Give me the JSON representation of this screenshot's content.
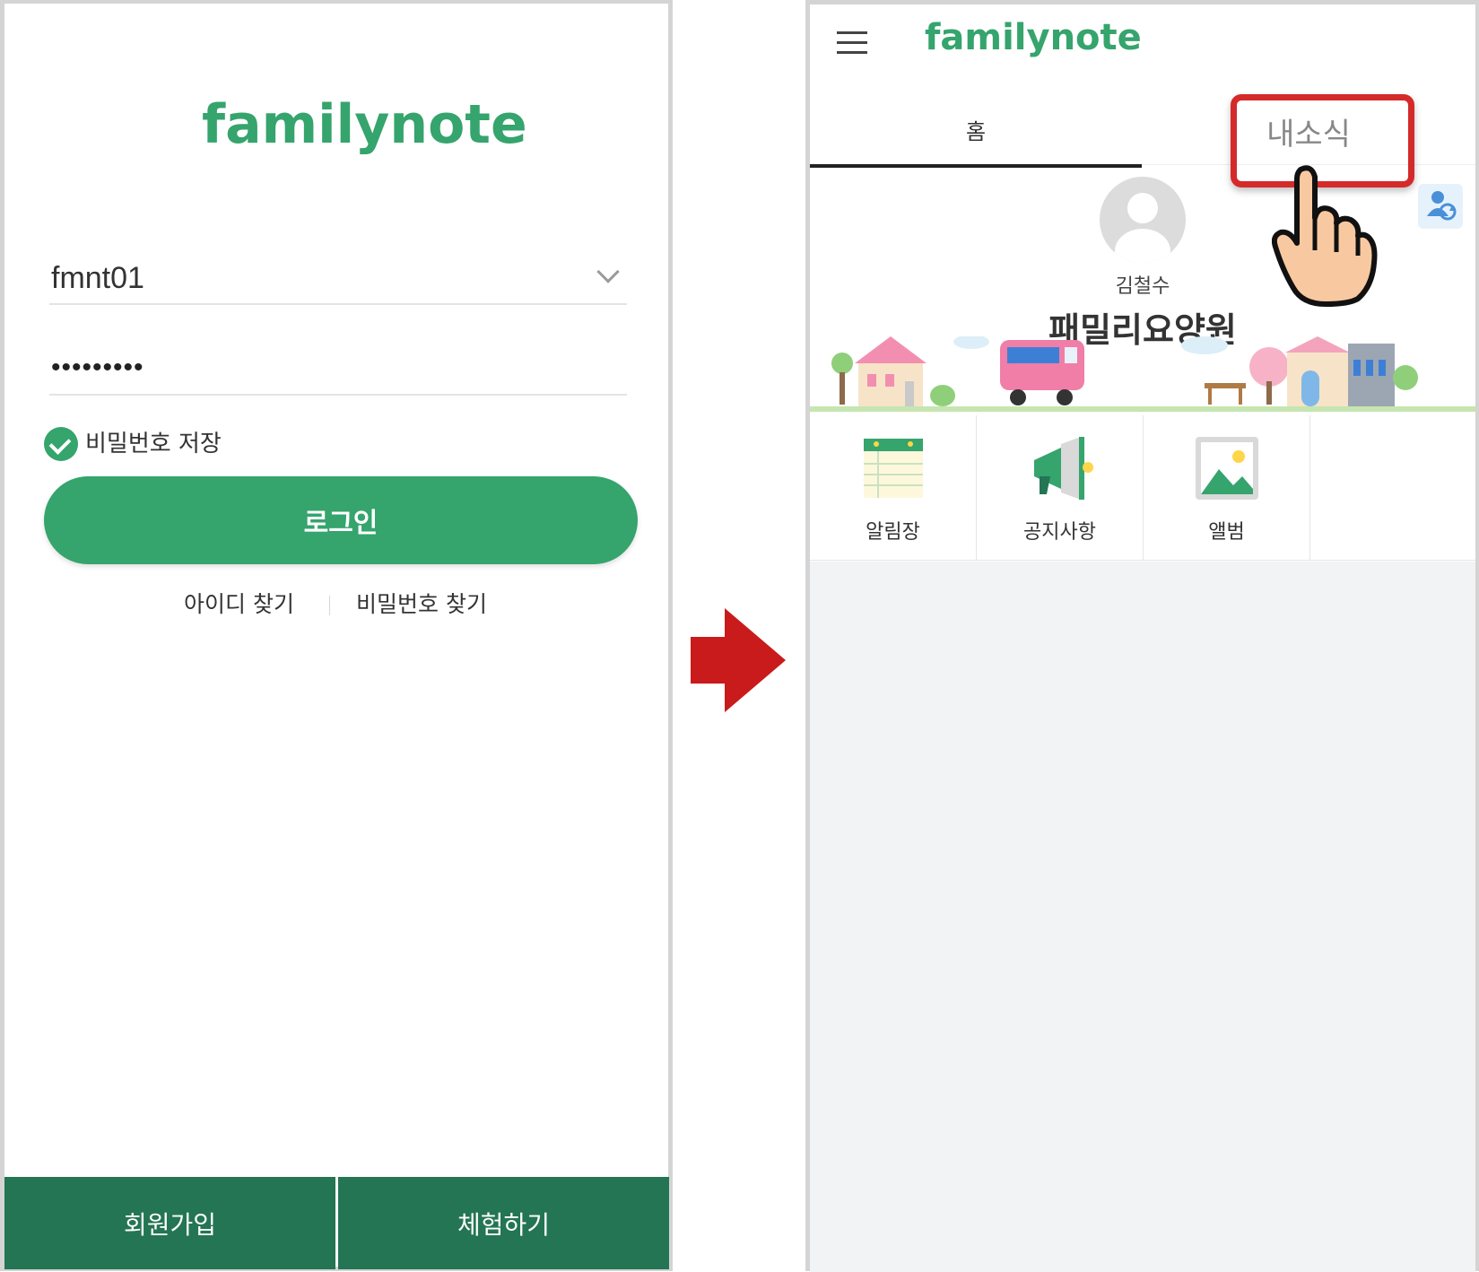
{
  "login": {
    "logo": "familynote",
    "user_id": "fmnt01",
    "password_masked": "•••••••••",
    "save_password_label": "비밀번호 저장",
    "save_password_checked": true,
    "login_label": "로그인",
    "find_id_label": "아이디 찾기",
    "find_password_label": "비밀번호 찾기",
    "signup_label": "회원가입",
    "trial_label": "체험하기"
  },
  "home": {
    "logo": "familynote",
    "tabs": [
      {
        "label": "홈",
        "active": true
      },
      {
        "label": "내소식",
        "active": false,
        "highlighted": true
      }
    ],
    "resident_name": "김철수",
    "facility_name": "패밀리요양원",
    "menu": [
      {
        "label": "알림장",
        "icon": "notebook-icon"
      },
      {
        "label": "공지사항",
        "icon": "megaphone-icon"
      },
      {
        "label": "앨범",
        "icon": "photo-album-icon"
      }
    ]
  },
  "colors": {
    "brand_green": "#35a46d",
    "dark_green": "#247553",
    "highlight_red": "#d42a2a",
    "arrow_red": "#c91b1b"
  }
}
